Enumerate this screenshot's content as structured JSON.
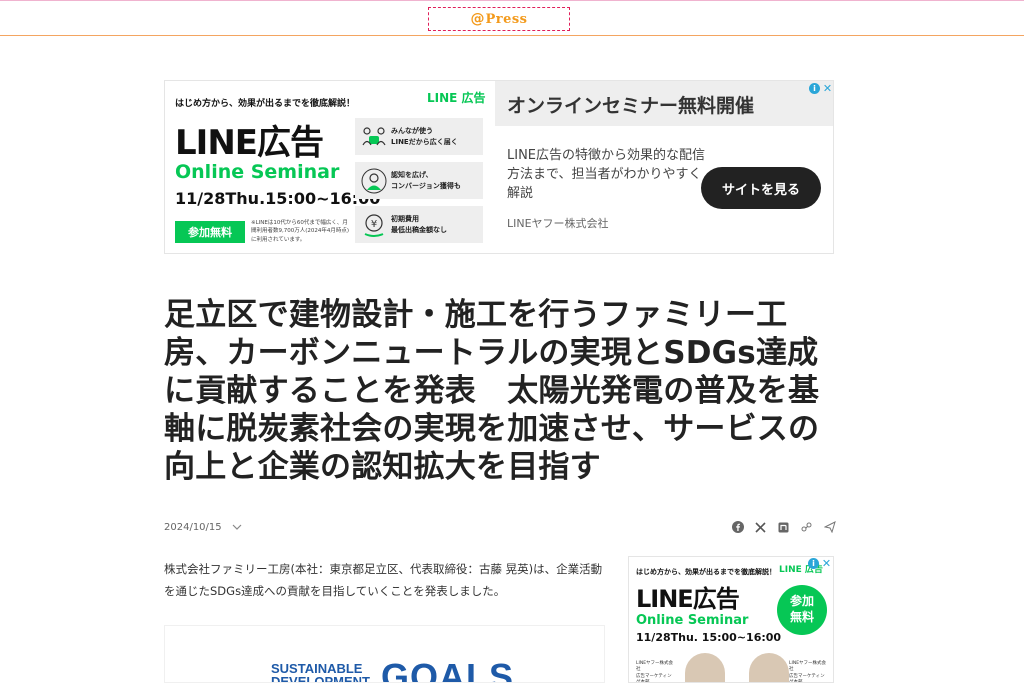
{
  "header": {
    "logo_at": "@",
    "logo_text": "Press"
  },
  "ad_top": {
    "pretitle": "はじめ方から、効果が出るまでを徹底解説！",
    "brand": "LINE 広告",
    "headline": "LINE広告",
    "seminar": "Online Seminar",
    "date": "11/28Thu.15:00~16:00",
    "cta": "参加無料",
    "fine_print": "※LINEは10代から60代まで幅広く、月間利用者数9,700万人(2024年4月時点)に利用されています。",
    "features": [
      {
        "icon": "people-icon",
        "text": "みんなが使う\nLINEだから広く届く"
      },
      {
        "icon": "person-icon",
        "text": "認知を広げ、\nコンバージョン獲得も"
      },
      {
        "icon": "yen-icon",
        "text": "初期費用\n最低出稿金額なし"
      }
    ],
    "right_title": "オンラインセミナー無料開催",
    "description": "LINE広告の特徴から効果的な配信方法まで、担当者がわかりやすく解説",
    "advertiser": "LINEヤフー株式会社",
    "button": "サイトを見る",
    "ad_info": "i",
    "ad_close": "✕"
  },
  "article": {
    "title": "足立区で建物設計・施工を行うファミリー工房、カーボンニュートラルの実現とSDGs達成に貢献することを発表　太陽光発電の普及を基軸に脱炭素社会の実現を加速させ、サービスの向上と企業の認知拡大を目指す",
    "date": "2024/10/15",
    "lead": "株式会社ファミリー工房(本社：東京都足立区、代表取締役：古藤 晃英)は、企業活動を通じたSDGs達成への貢献を目指していくことを発表しました。",
    "figure_sub": "SUSTAINABLE\nDEVELOPMENT",
    "figure_goals": "GOALS"
  },
  "share": [
    "facebook-icon",
    "x-icon",
    "note-icon",
    "link-icon",
    "send-icon"
  ],
  "ad_side": {
    "pretitle": "はじめ方から、効果が出るまでを徹底解説！",
    "brand": "LINE 広告",
    "headline": "LINE広告",
    "seminar": "Online Seminar",
    "date": "11/28Thu. 15:00~16:00",
    "circle": "参加\n無料",
    "tag_a": "LINEヤフー株式会社\n広告マーケティング本部\n佐々木 未来",
    "tag_b": "LINEヤフー株式会社\n広告マーケティング本部\n和田 智和花",
    "ad_info": "i",
    "ad_close": "✕"
  },
  "colors": {
    "line_green": "#06c755",
    "press_orange": "#f39a1c",
    "sdgs_blue": "#1e5aa8"
  }
}
